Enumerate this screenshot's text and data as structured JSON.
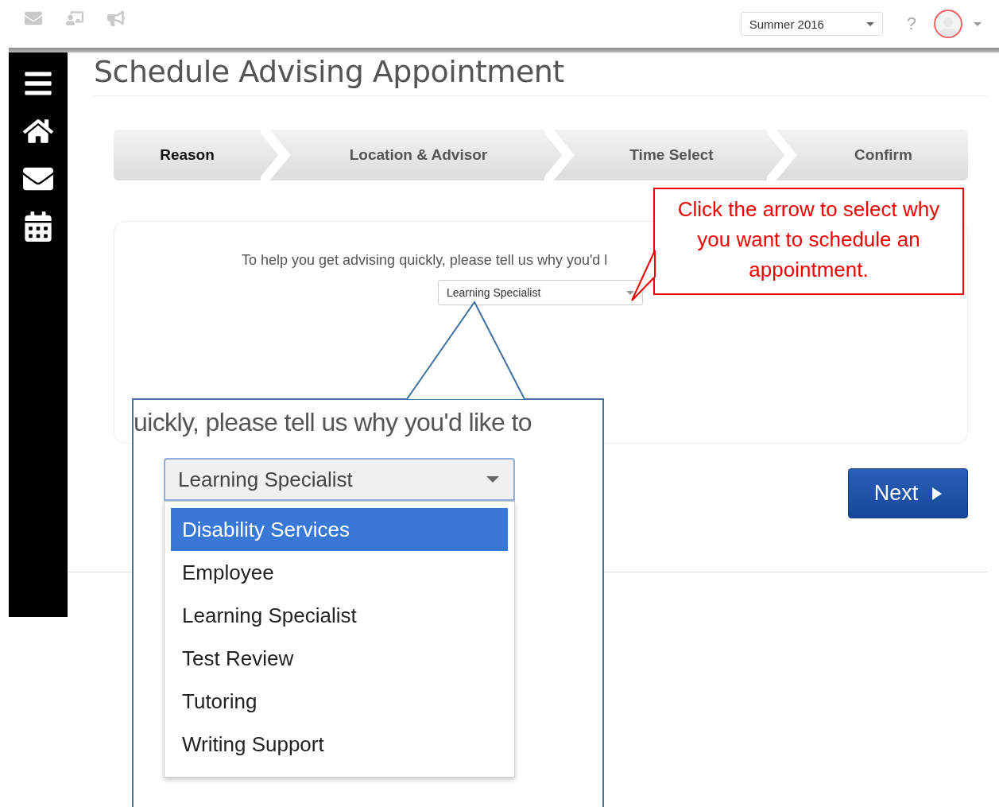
{
  "top_bar": {
    "term_select": {
      "value": "Summer 2016"
    },
    "help": "?"
  },
  "page_title": "Schedule Advising Appointment",
  "steps": [
    {
      "label": "Reason",
      "selected": true
    },
    {
      "label": "Location & Advisor",
      "selected": false
    },
    {
      "label": "Time Select",
      "selected": false
    },
    {
      "label": "Confirm",
      "selected": false
    }
  ],
  "prompt": "To help you get advising quickly, please tell us why you'd l",
  "reason_select": {
    "value": "Learning Specialist"
  },
  "next_button": "Next",
  "callout": "Click the arrow to select why you want to schedule an appointment.",
  "zoom_inset": {
    "prompt_fragment": "uickly, please tell us why you'd like to",
    "select_value": "Learning Specialist",
    "options": [
      {
        "label": "Disability Services",
        "selected": true
      },
      {
        "label": "Employee",
        "selected": false
      },
      {
        "label": "Learning Specialist",
        "selected": false
      },
      {
        "label": "Test Review",
        "selected": false
      },
      {
        "label": "Tutoring",
        "selected": false
      },
      {
        "label": "Writing Support",
        "selected": false
      }
    ]
  }
}
